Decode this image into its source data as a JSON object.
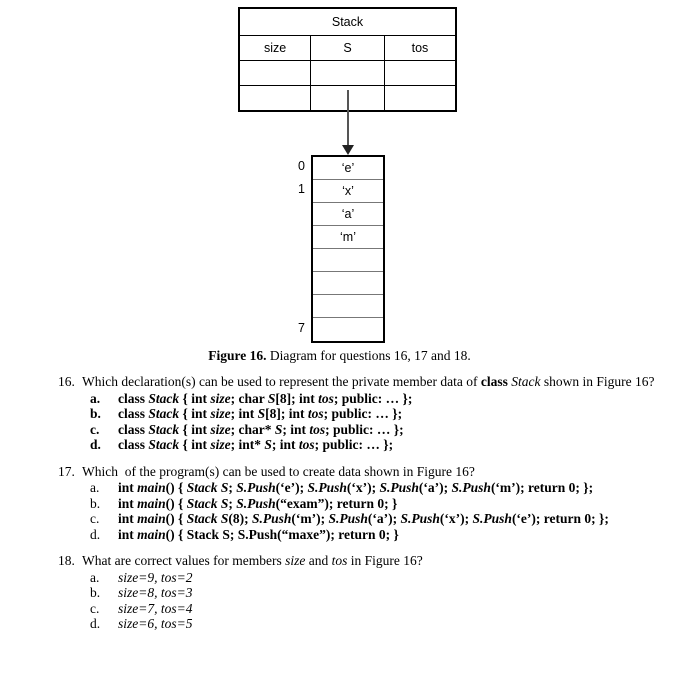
{
  "figure": {
    "table": {
      "title": "Stack",
      "columns": [
        "size",
        "S",
        "tos"
      ],
      "empty_rows": 2
    },
    "array": {
      "cells": [
        "‘e’",
        "‘x’",
        "‘a’",
        "‘m’",
        "",
        "",
        "",
        ""
      ],
      "index_labels": {
        "first": "0",
        "second": "1",
        "last": "7"
      }
    },
    "caption_label": "Figure 16.",
    "caption_text": "Diagram for questions 16, 17 and 18."
  },
  "questions": [
    {
      "number": "16.",
      "text_html": "Which declaration(s) can be used to represent the private member data of <b>class</b> <i>Stack</i> shown in Figure 16?",
      "option_style": "bold",
      "options": [
        {
          "letter": "a.",
          "html": "<b>class</b> <i><b>Stack</b></i> <b>{ int</b> <i><b>size</b></i><b>; char</b> <i><b>S</b></i><b>[8]; int</b> <i><b>tos</b></i><b>; public: … };</b>"
        },
        {
          "letter": "b.",
          "html": "<b>class</b> <i><b>Stack</b></i> <b>{ int</b> <i><b>size</b></i><b>; int</b> <i><b>S</b></i><b>[8]; int</b> <i><b>tos</b></i><b>; public: … };</b>"
        },
        {
          "letter": "c.",
          "html": "<b>class</b> <i><b>Stack</b></i> <b>{ int</b> <i><b>size</b></i><b>; char*</b> <i><b>S</b></i><b>; int</b> <i><b>tos</b></i><b>; public: … };</b>"
        },
        {
          "letter": "d.",
          "html": "<b>class</b> <i><b>Stack</b></i> <b>{ int</b> <i><b>size</b></i><b>; int*</b> <i><b>S</b></i><b>; int</b> <i><b>tos</b></i><b>; public: … };</b>"
        }
      ]
    },
    {
      "number": "17.",
      "text_html": "Which&nbsp; of the program(s) can be used to create data shown in Figure 16?",
      "option_style": "plain-letter",
      "options": [
        {
          "letter": "a.",
          "html": "<b>int</b> <i><b>main</b></i><b>() {</b> <i><b>Stack S</b></i><b>;</b> <i><b>S.Push</b></i><b>(‘e’);</b> <i><b>S.Push</b></i><b>(‘x’);</b> <i><b>S.Push</b></i><b>(‘a’);</b> <i><b>S.Push</b></i><b>(‘m’); return 0; };</b>"
        },
        {
          "letter": "b.",
          "html": "<b>int</b> <i><b>main</b></i><b>() {</b> <i><b>Stack S</b></i><b>;</b> <i><b>S.Push</b></i><b>(“exam”); return 0; }</b>"
        },
        {
          "letter": "c.",
          "html": "<b>int</b> <i><b>main</b></i><b>() {</b> <i><b>Stack S</b></i><b>(8);</b> <i><b>S.Push</b></i><b>(‘m’);</b> <i><b>S.Push</b></i><b>(‘a’);</b> <i><b>S.Push</b></i><b>(‘x’);</b> <i><b>S.Push</b></i><b>(‘e’); return 0; };</b>"
        },
        {
          "letter": "d.",
          "html": "<b>int</b> <i><b>main</b></i><b>() { Stack S; S.Push(“maxe”); return 0; }</b>"
        }
      ]
    },
    {
      "number": "18.",
      "text_html": "What are correct values for members <i>size</i> and <i>tos</i> in Figure 16?",
      "option_style": "italic",
      "options": [
        {
          "letter": "a.",
          "html": "<i>size</i>=9, <i>tos</i>=2"
        },
        {
          "letter": "b.",
          "html": "<i>size</i>=8, <i>tos</i>=3"
        },
        {
          "letter": "c.",
          "html": "<i>size</i>=7, <i>tos</i>=4"
        },
        {
          "letter": "d.",
          "html": "<i>size</i>=6, <i>tos</i>=5"
        }
      ]
    }
  ]
}
